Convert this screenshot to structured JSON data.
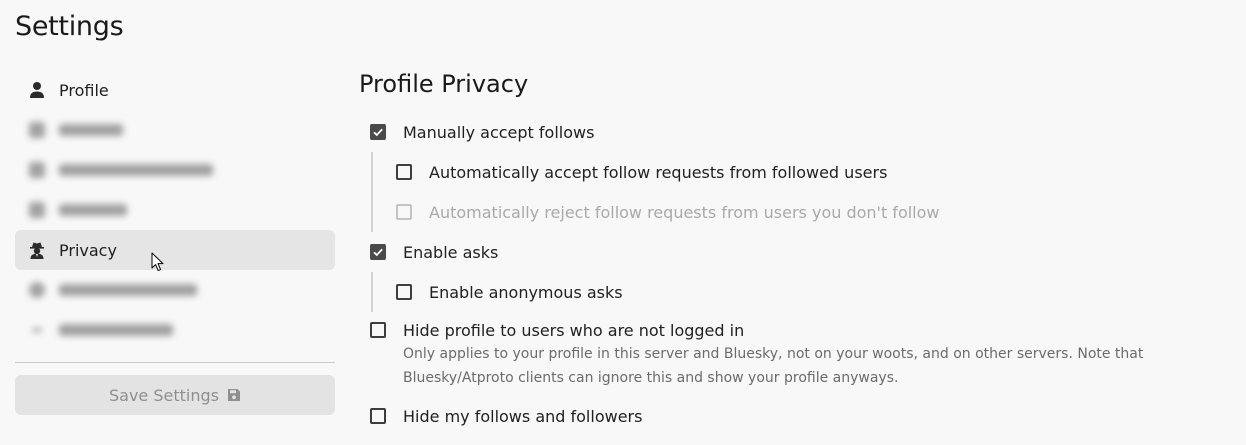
{
  "page": {
    "title": "Settings"
  },
  "sidebar": {
    "items": [
      {
        "label": "Profile",
        "icon": "person-icon",
        "state": "normal"
      },
      {
        "label": "",
        "icon": "blurred-icon",
        "state": "blurred"
      },
      {
        "label": "",
        "icon": "blurred-icon",
        "state": "blurred"
      },
      {
        "label": "",
        "icon": "blurred-icon",
        "state": "blurred"
      },
      {
        "label": "Privacy",
        "icon": "spy-icon",
        "state": "active"
      },
      {
        "label": "",
        "icon": "blurred-icon",
        "state": "blurred"
      },
      {
        "label": "",
        "icon": "blurred-icon",
        "state": "blurred"
      }
    ],
    "save_label": "Save Settings",
    "save_icon": "floppy-disk-icon"
  },
  "main": {
    "section_title": "Profile Privacy",
    "options": {
      "manually_accept": {
        "label": "Manually accept follows",
        "checked": true
      },
      "auto_accept": {
        "label": "Automatically accept follow requests from followed users",
        "checked": false
      },
      "auto_reject": {
        "label": "Automatically reject follow requests from users you don't follow",
        "checked": false,
        "disabled": true
      },
      "enable_asks": {
        "label": "Enable asks",
        "checked": true
      },
      "anonymous_asks": {
        "label": "Enable anonymous asks",
        "checked": false
      },
      "hide_profile": {
        "label": "Hide profile to users who are not logged in",
        "checked": false,
        "description_line1": "Only applies to your profile in this server and Bluesky, not on your woots, and on other servers. Note that",
        "description_line2": "Bluesky/Atproto clients can ignore this and show your profile anyways."
      },
      "hide_follows": {
        "label": "Hide my follows and followers",
        "checked": false
      }
    }
  },
  "colors": {
    "background": "#f8f8f8",
    "active_nav": "#e5e5e5",
    "checkbox_checked": "#4a4a4a",
    "disabled_text": "#a9a9a9"
  }
}
